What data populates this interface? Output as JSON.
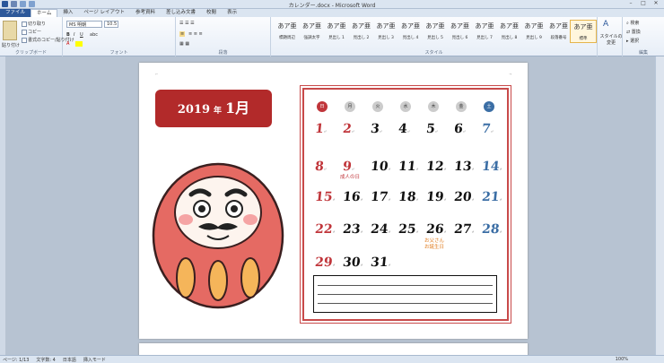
{
  "window": {
    "title": "カレンダー.docx - Microsoft Word"
  },
  "ribbon_tabs": [
    "ファイル",
    "ホーム",
    "挿入",
    "ページ レイアウト",
    "参考資料",
    "差し込み文書",
    "校閲",
    "表示"
  ],
  "clipboard": {
    "paste": "貼り付け",
    "cut": "切り取り",
    "copy": "コピー",
    "format_painter": "書式のコピー/貼り付け",
    "label": "クリップボード"
  },
  "font": {
    "name": "MS 明朝",
    "size": "10.5",
    "label": "フォント"
  },
  "paragraph": {
    "label": "段落"
  },
  "styles": {
    "items": [
      {
        "preview": "あア亜",
        "name": "標題周辺"
      },
      {
        "preview": "あア亜",
        "name": "強調太字"
      },
      {
        "preview": "あア亜",
        "name": "見出し 1"
      },
      {
        "preview": "あア亜",
        "name": "見出し 2"
      },
      {
        "preview": "あア亜",
        "name": "見出し 3"
      },
      {
        "preview": "あア亜",
        "name": "見出し 4"
      },
      {
        "preview": "あア亜",
        "name": "見出し 5"
      },
      {
        "preview": "あア亜",
        "name": "見出し 6"
      },
      {
        "preview": "あア亜",
        "name": "見出し 7"
      },
      {
        "preview": "あア亜",
        "name": "見出し 8"
      },
      {
        "preview": "あア亜",
        "name": "見出し 9"
      },
      {
        "preview": "あア亜",
        "name": "段落番号"
      },
      {
        "preview": "あア亜",
        "name": "標準"
      }
    ],
    "change_styles": "スタイルの変更",
    "label": "スタイル"
  },
  "editing": {
    "find": "検索",
    "replace": "置換",
    "select": "選択",
    "label": "編集"
  },
  "document": {
    "year": "2019",
    "nen": "年",
    "month": "1月",
    "weekdays": [
      "日",
      "月",
      "火",
      "水",
      "木",
      "金",
      "土"
    ],
    "weekday_colors": [
      "#c0353a",
      "#cccccc",
      "#cccccc",
      "#cccccc",
      "#cccccc",
      "#cccccc",
      "#3b6ea5"
    ],
    "days": [
      {
        "d": "1",
        "c": "red"
      },
      {
        "d": "2",
        "c": "red"
      },
      {
        "d": "3",
        "c": ""
      },
      {
        "d": "4",
        "c": ""
      },
      {
        "d": "5",
        "c": ""
      },
      {
        "d": "6",
        "c": ""
      },
      {
        "d": "7",
        "c": "blue"
      },
      {
        "d": "8",
        "c": "red"
      },
      {
        "d": "9",
        "c": "red"
      },
      {
        "d": "10",
        "c": ""
      },
      {
        "d": "11",
        "c": ""
      },
      {
        "d": "12",
        "c": ""
      },
      {
        "d": "13",
        "c": ""
      },
      {
        "d": "14",
        "c": "blue"
      },
      {
        "d": "15",
        "c": "red"
      },
      {
        "d": "16",
        "c": ""
      },
      {
        "d": "17",
        "c": ""
      },
      {
        "d": "18",
        "c": ""
      },
      {
        "d": "19",
        "c": ""
      },
      {
        "d": "20",
        "c": ""
      },
      {
        "d": "21",
        "c": "blue"
      },
      {
        "d": "22",
        "c": "red"
      },
      {
        "d": "23",
        "c": ""
      },
      {
        "d": "24",
        "c": ""
      },
      {
        "d": "25",
        "c": ""
      },
      {
        "d": "26",
        "c": ""
      },
      {
        "d": "27",
        "c": ""
      },
      {
        "d": "28",
        "c": "blue"
      },
      {
        "d": "29",
        "c": "red"
      },
      {
        "d": "30",
        "c": ""
      },
      {
        "d": "31",
        "c": ""
      }
    ],
    "holiday_note": "成人の日",
    "birthday_note_1": "お父さん",
    "birthday_note_2": "お誕生日"
  },
  "statusbar": {
    "page": "ページ: 1/13",
    "words": "文字数: 4",
    "lang": "日本語",
    "mode": "挿入モード",
    "zoom": "100%"
  }
}
